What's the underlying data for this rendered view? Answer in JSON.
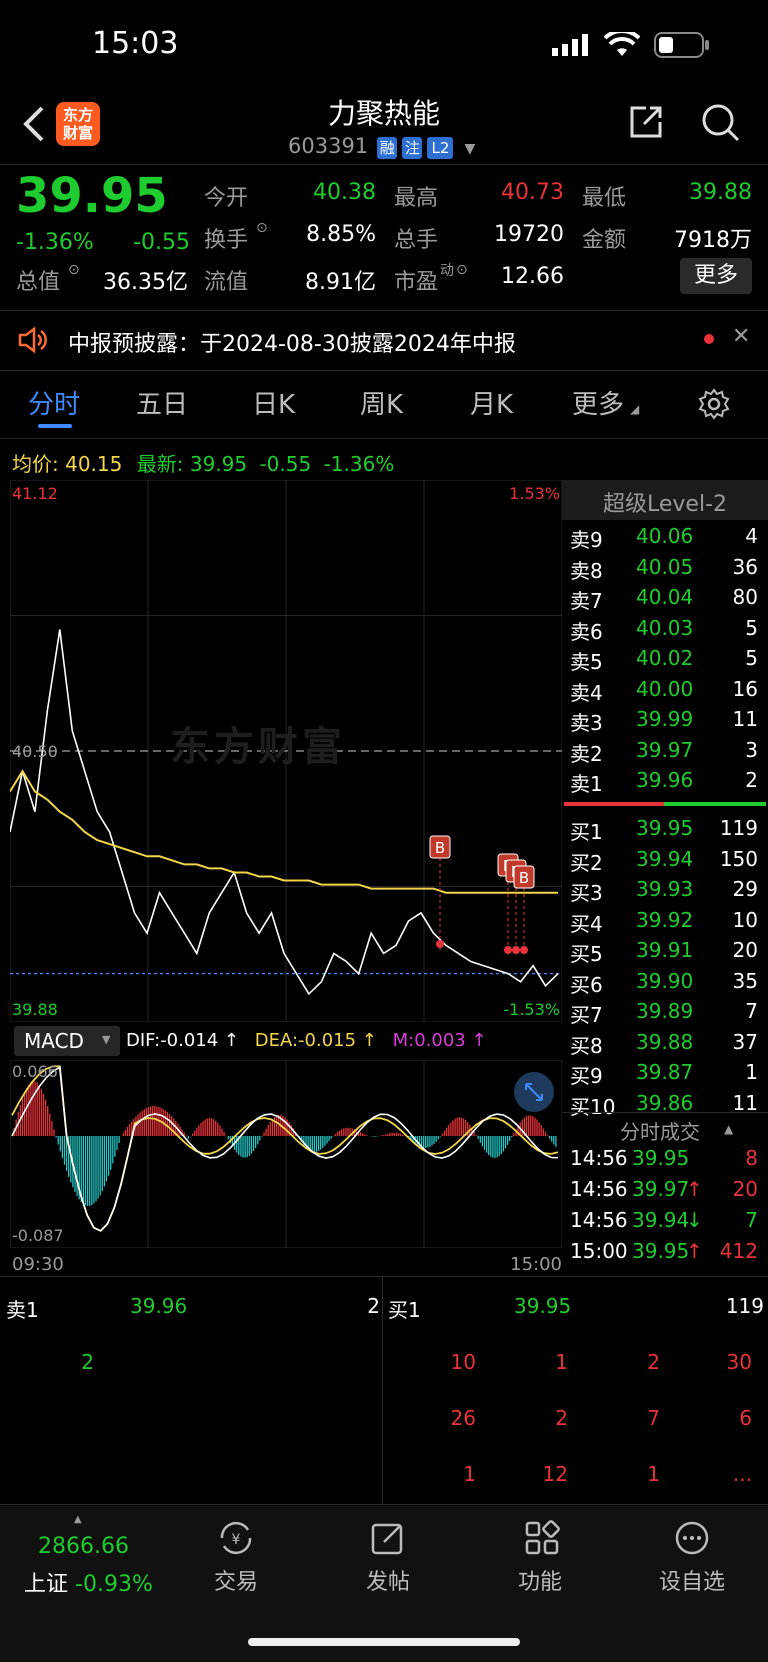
{
  "status_bar": {
    "time": "15:03"
  },
  "header": {
    "back_label": "<",
    "logo_text": "东方\n财富",
    "title": "力聚热能",
    "code": "603391",
    "badges": [
      "融",
      "注",
      "L2"
    ]
  },
  "quote": {
    "price": "39.95",
    "change_pct": "-1.36%",
    "change": "-0.55",
    "fields": [
      {
        "label": "今开",
        "value": "40.38"
      },
      {
        "label": "最高",
        "value": "40.73"
      },
      {
        "label": "最低",
        "value": "39.88"
      },
      {
        "label": "换手",
        "value": "8.85%"
      },
      {
        "label": "总手",
        "value": "19720"
      },
      {
        "label": "金额",
        "value": "7918万"
      },
      {
        "label": "总值",
        "value": "36.35亿"
      },
      {
        "label": "流值",
        "value": "8.91亿"
      },
      {
        "label": "市盈",
        "value": "12.66"
      }
    ],
    "pe_sup": "动",
    "more_button": "更多"
  },
  "notice": {
    "text": "中报预披露：于2024-08-30披露2024年中报"
  },
  "tabs": [
    "分时",
    "五日",
    "日K",
    "周K",
    "月K",
    "更多"
  ],
  "avg_line": {
    "avg_label": "均价:",
    "avg_value": "40.15",
    "latest_label": "最新:",
    "latest_value": "39.95",
    "chg": "-0.55",
    "pct": "-1.36%"
  },
  "chart_data": {
    "type": "line",
    "title": "",
    "y_high": "41.12",
    "y_low": "39.88",
    "pct_high": "1.53%",
    "pct_low": "-1.53%",
    "prev_close": "40.50",
    "x_start": "09:30",
    "x_end": "15:00",
    "watermark": "东方财富",
    "trade_marks": [
      "B",
      "B",
      "B",
      "B"
    ],
    "series": [
      {
        "values": [
          40.3,
          40.45,
          40.35,
          40.6,
          40.8,
          40.55,
          40.45,
          40.35,
          40.3,
          40.2,
          40.1,
          40.05,
          40.15,
          40.1,
          40.05,
          40.0,
          40.1,
          40.15,
          40.2,
          40.1,
          40.05,
          40.1,
          40.0,
          39.95,
          39.9,
          39.93,
          40.0,
          39.98,
          39.95,
          40.05,
          40.0,
          40.02,
          40.08,
          40.1,
          40.05,
          40.02,
          40.0,
          39.98,
          39.97,
          39.96,
          39.95,
          39.93,
          39.97,
          39.92,
          39.95
        ]
      },
      {
        "values": [
          40.4,
          40.45,
          40.4,
          40.38,
          40.35,
          40.33,
          40.3,
          40.28,
          40.27,
          40.26,
          40.25,
          40.24,
          40.24,
          40.23,
          40.22,
          40.22,
          40.21,
          40.21,
          40.2,
          40.2,
          40.19,
          40.19,
          40.18,
          40.18,
          40.18,
          40.17,
          40.17,
          40.17,
          40.17,
          40.16,
          40.16,
          40.16,
          40.16,
          40.16,
          40.16,
          40.15,
          40.15,
          40.15,
          40.15,
          40.15,
          40.15,
          40.15,
          40.15,
          40.15,
          40.15
        ]
      }
    ]
  },
  "macd": {
    "label": "MACD",
    "dif": "DIF:-0.014 ↑",
    "dea": "DEA:-0.015 ↑",
    "m": "M:0.003 ↑",
    "top": "0.066",
    "bottom": "-0.087"
  },
  "orderbook": {
    "title": "超级Level-2",
    "asks": [
      {
        "label": "卖9",
        "price": "40.06",
        "vol": "4"
      },
      {
        "label": "卖8",
        "price": "40.05",
        "vol": "36"
      },
      {
        "label": "卖7",
        "price": "40.04",
        "vol": "80"
      },
      {
        "label": "卖6",
        "price": "40.03",
        "vol": "5"
      },
      {
        "label": "卖5",
        "price": "40.02",
        "vol": "5"
      },
      {
        "label": "卖4",
        "price": "40.00",
        "vol": "16"
      },
      {
        "label": "卖3",
        "price": "39.99",
        "vol": "11"
      },
      {
        "label": "卖2",
        "price": "39.97",
        "vol": "3"
      },
      {
        "label": "卖1",
        "price": "39.96",
        "vol": "2"
      }
    ],
    "bids": [
      {
        "label": "买1",
        "price": "39.95",
        "vol": "119"
      },
      {
        "label": "买2",
        "price": "39.94",
        "vol": "150"
      },
      {
        "label": "买3",
        "price": "39.93",
        "vol": "29"
      },
      {
        "label": "买4",
        "price": "39.92",
        "vol": "10"
      },
      {
        "label": "买5",
        "price": "39.91",
        "vol": "20"
      },
      {
        "label": "买6",
        "price": "39.90",
        "vol": "35"
      },
      {
        "label": "买7",
        "price": "39.89",
        "vol": "7"
      },
      {
        "label": "买8",
        "price": "39.88",
        "vol": "37"
      },
      {
        "label": "买9",
        "price": "39.87",
        "vol": "1"
      },
      {
        "label": "买10",
        "price": "39.86",
        "vol": "11"
      }
    ]
  },
  "ticks": {
    "title": "分时成交",
    "rows": [
      {
        "time": "14:56",
        "price": "39.95",
        "dir": "",
        "vol": "8"
      },
      {
        "time": "14:56",
        "price": "39.97",
        "dir": "↑",
        "vol": "20"
      },
      {
        "time": "14:56",
        "price": "39.94",
        "dir": "↓",
        "vol": "7"
      },
      {
        "time": "15:00",
        "price": "39.95",
        "dir": "↑",
        "vol": "412"
      }
    ]
  },
  "queue": {
    "ask_label": "卖1",
    "ask_price": "39.96",
    "ask_vol": "2",
    "bid_label": "买1",
    "bid_price": "39.95",
    "bid_vol": "119",
    "ask_orders": [
      "2"
    ],
    "bid_orders": [
      "10",
      "1",
      "2",
      "30",
      "26",
      "2",
      "7",
      "6",
      "1",
      "12",
      "1",
      "..."
    ]
  },
  "bottom_nav": {
    "index_value": "2866.66",
    "index_name": "上证",
    "index_pct": "-0.93%",
    "items": [
      "交易",
      "发帖",
      "功能",
      "设自选"
    ]
  }
}
